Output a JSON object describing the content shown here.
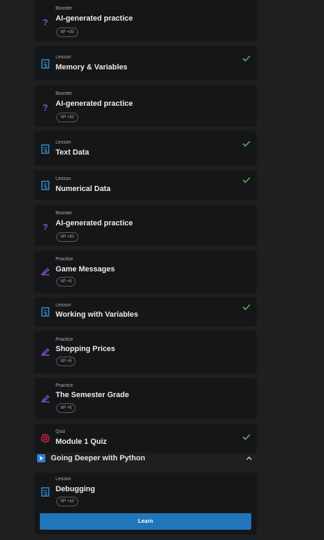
{
  "items": [
    {
      "type": "Booster",
      "title": "AI-generated practice",
      "xp": "XP +20",
      "done": false
    },
    {
      "type": "Lesson",
      "title": "Memory & Variables",
      "xp": "",
      "done": true
    },
    {
      "type": "Booster",
      "title": "AI-generated practice",
      "xp": "XP +20",
      "done": false
    },
    {
      "type": "Lesson",
      "title": "Text Data",
      "xp": "",
      "done": true
    },
    {
      "type": "Lesson",
      "title": "Numerical Data",
      "xp": "",
      "done": true
    },
    {
      "type": "Booster",
      "title": "AI-generated practice",
      "xp": "XP +20",
      "done": false
    },
    {
      "type": "Practice",
      "title": "Game Messages",
      "xp": "XP +5",
      "done": false
    },
    {
      "type": "Lesson",
      "title": "Working with Variables",
      "xp": "",
      "done": true
    },
    {
      "type": "Practice",
      "title": "Shopping Prices",
      "xp": "XP +5",
      "done": false
    },
    {
      "type": "Practice",
      "title": "The Semester Grade",
      "xp": "XP +5",
      "done": false
    },
    {
      "type": "Quiz",
      "title": "Module 1 Quiz",
      "xp": "",
      "done": true
    }
  ],
  "section": {
    "title": "Going Deeper with Python",
    "icon": "play-icon"
  },
  "next": {
    "type": "Lesson",
    "title": "Debugging",
    "xp": "XP +10",
    "button": "Learn"
  },
  "colors": {
    "check": "#4fb84f",
    "booster": "#8b4fd6",
    "lesson": "#2f8ed7",
    "practice": "#8b4fd6",
    "quiz": "#e0234b",
    "learn": "#2076bb"
  }
}
